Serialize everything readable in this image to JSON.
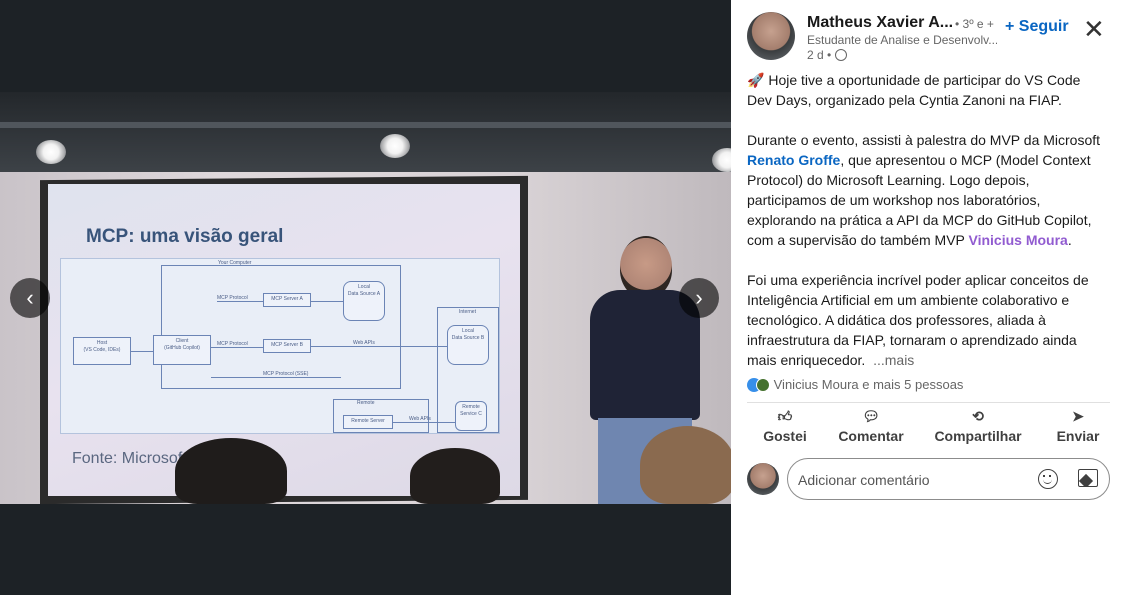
{
  "media": {
    "slide_title": "MCP: uma visão geral",
    "slide_source": "Fonte: Microsoft",
    "diagram": {
      "group_your_computer": "Your Computer",
      "group_internet": "Internet",
      "group_remote": "Remote",
      "host": "Host\n(VS Code, IDEs)",
      "client": "Client\n(GitHub Copilot)",
      "server_a": "MCP Server A",
      "server_b": "MCP Server B",
      "local_a": "Local\nData Source A",
      "local_b": "Local\nData Source B",
      "remote_server": "Remote Server",
      "remote_service": "Remote\nService C",
      "protocol": "MCP Protocol",
      "protocol_sse": "MCP Protocol (SSE)",
      "web_apis": "Web APIs"
    },
    "prev_label": "‹",
    "next_label": "›"
  },
  "header": {
    "name": "Matheus Xavier A...",
    "degree": "• 3º e +",
    "headline": "Estudante de Analise e Desenvolv...",
    "time": "2 d •",
    "follow_label": "+ Seguir",
    "close_label": "✕"
  },
  "post": {
    "p1_icon": "rocket-icon",
    "p1_text": "Hoje tive a oportunidade de participar do VS Code Dev Days, organizado pela Cyntia Zanoni na FIAP.",
    "p2_a": "Durante o evento, assisti à palestra do MVP da Microsoft ",
    "p2_mention1": "Renato Groffe",
    "p2_b": ", que apresentou o MCP (Model Context Protocol) do Microsoft Learning. Logo depois, participamos de um workshop nos laboratórios, explorando na prática a API da MCP do GitHub Copilot, com a supervisão do também MVP ",
    "p2_mention2": "Vinicius Moura",
    "p2_c": ".",
    "p3_text": "Foi uma experiência incrível poder aplicar conceitos de Inteligência Artificial em um ambiente colaborativo e tecnológico. A didática dos professores, aliada à infraestrutura da FIAP, tornaram o aprendizado ainda mais enriquecedor.",
    "more_label": "...mais"
  },
  "reactions": {
    "text": "Vinicius Moura e mais 5 pessoas"
  },
  "actions": {
    "like": "Gostei",
    "comment": "Comentar",
    "share": "Compartilhar",
    "send": "Enviar"
  },
  "comment": {
    "placeholder": "Adicionar comentário"
  },
  "colors": {
    "link_blue": "#0a66c2",
    "mention_purple": "#915bd0",
    "media_bg": "#1d2226"
  }
}
